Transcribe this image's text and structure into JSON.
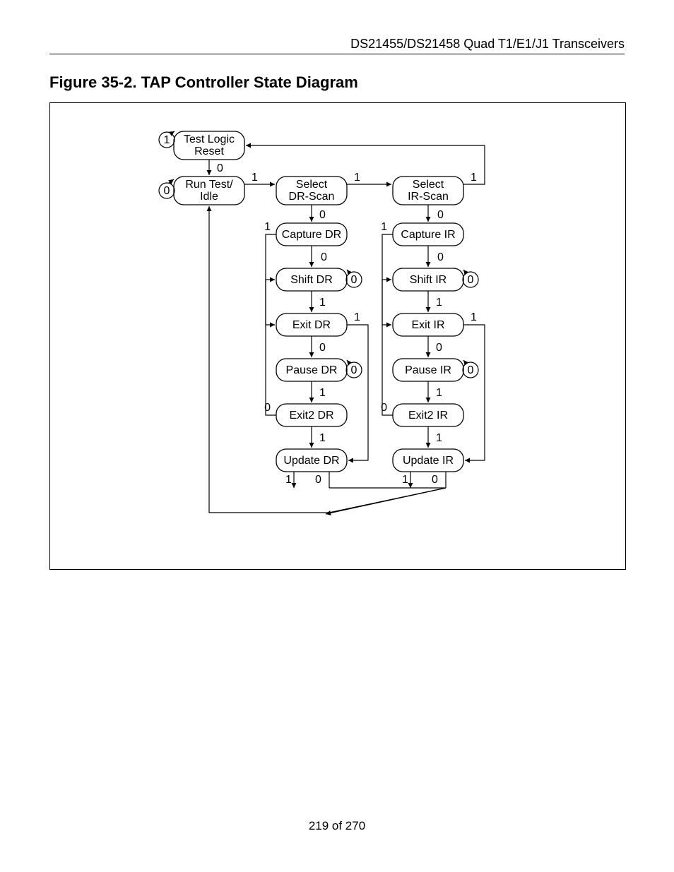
{
  "header": "DS21455/DS21458 Quad T1/E1/J1 Transceivers",
  "figure_title": "Figure 35-2. TAP Controller State Diagram",
  "footer": "219 of 270",
  "states": {
    "tlr": {
      "l1": "Test Logic",
      "l2": "Reset"
    },
    "rti": {
      "l1": "Run Test/",
      "l2": "Idle"
    },
    "sdr": {
      "l1": "Select",
      "l2": "DR-Scan"
    },
    "sir": {
      "l1": "Select",
      "l2": "IR-Scan"
    },
    "cdr": {
      "l1": "Capture DR"
    },
    "cir": {
      "l1": "Capture IR"
    },
    "shdr": {
      "l1": "Shift DR"
    },
    "shir": {
      "l1": "Shift IR"
    },
    "edr": {
      "l1": "Exit DR"
    },
    "eir": {
      "l1": "Exit IR"
    },
    "pdr": {
      "l1": "Pause DR"
    },
    "pir": {
      "l1": "Pause IR"
    },
    "e2dr": {
      "l1": "Exit2 DR"
    },
    "e2ir": {
      "l1": "Exit2 IR"
    },
    "udr": {
      "l1": "Update DR"
    },
    "uir": {
      "l1": "Update IR"
    }
  },
  "labels": {
    "zero": "0",
    "one": "1"
  }
}
